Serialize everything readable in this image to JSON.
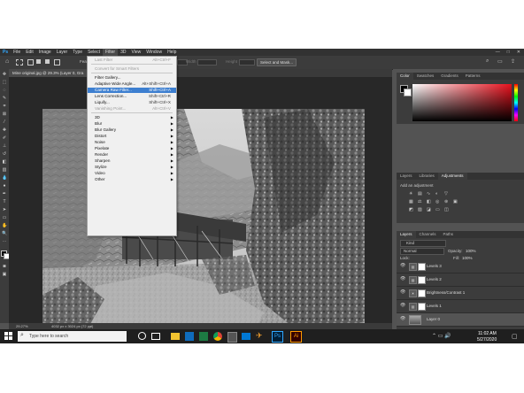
{
  "menubar": {
    "items": [
      "File",
      "Edit",
      "Image",
      "Layer",
      "Type",
      "Select",
      "Filter",
      "3D",
      "View",
      "Window",
      "Help"
    ],
    "active_index": 6,
    "window_controls": [
      "—",
      "□",
      "✕"
    ]
  },
  "options_bar": {
    "feather_label": "Feat",
    "width_label": "Width",
    "height_label": "Height",
    "select_mask_label": "Select and Mask..."
  },
  "document_tab": {
    "label": "Mine original.jpg @ 29.3% (Layer 0, Gra"
  },
  "status_bar": {
    "zoom": "29.27%",
    "doc_size": "4032 px x 3024 px (72 ppi)"
  },
  "filter_menu": {
    "items": [
      {
        "label": "Last Filter",
        "shortcut": "Alt+Ctrl+F",
        "disabled": true
      },
      {
        "separator": true
      },
      {
        "label": "Convert for Smart Filters",
        "shortcut": "",
        "disabled": true
      },
      {
        "separator": true
      },
      {
        "label": "Filter Gallery...",
        "shortcut": ""
      },
      {
        "label": "Adaptive Wide Angle...",
        "shortcut": "Alt+Shift+Ctrl+A"
      },
      {
        "label": "Camera Raw Filter...",
        "shortcut": "Shift+Ctrl+A",
        "highlighted": true
      },
      {
        "label": "Lens Correction...",
        "shortcut": "Shift+Ctrl+R"
      },
      {
        "label": "Liquify...",
        "shortcut": "Shift+Ctrl+X"
      },
      {
        "label": "Vanishing Point...",
        "shortcut": "Alt+Ctrl+V",
        "disabled": true
      },
      {
        "separator": true
      },
      {
        "label": "3D",
        "submenu": true
      },
      {
        "label": "Blur",
        "submenu": true
      },
      {
        "label": "Blur Gallery",
        "submenu": true
      },
      {
        "label": "Distort",
        "submenu": true
      },
      {
        "label": "Noise",
        "submenu": true
      },
      {
        "label": "Pixelate",
        "submenu": true
      },
      {
        "label": "Render",
        "submenu": true
      },
      {
        "label": "Sharpen",
        "submenu": true
      },
      {
        "label": "Stylize",
        "submenu": true
      },
      {
        "label": "Video",
        "submenu": true
      },
      {
        "label": "Other",
        "submenu": true
      }
    ]
  },
  "color_panel": {
    "tabs": [
      "Color",
      "Swatches",
      "Gradients",
      "Patterns"
    ],
    "active": 0
  },
  "adjust_panel": {
    "tabs": [
      "Layers",
      "Libraries",
      "Adjustments"
    ],
    "active": 2,
    "hint": "Add an adjustment"
  },
  "layers_panel": {
    "tabs": [
      "Layers",
      "Channels",
      "Paths"
    ],
    "kind_label": "Kind",
    "blend_mode": "Normal",
    "opacity_label": "Opacity:",
    "opacity": "100%",
    "lock_label": "Lock:",
    "fill_label": "Fill:",
    "fill": "100%",
    "layers": [
      {
        "name": "Levels 3",
        "icon": "levels-icon"
      },
      {
        "name": "Levels 2",
        "icon": "levels-icon"
      },
      {
        "name": "Brightness/Contrast 1",
        "icon": "brightness-icon"
      },
      {
        "name": "Levels 1",
        "icon": "levels-icon"
      },
      {
        "name": "Layer 0",
        "icon": "image-thumb",
        "selected": true
      }
    ]
  },
  "taskbar": {
    "search_placeholder": "Type here to search",
    "time": "11:02 AM",
    "date": "5/27/2020",
    "ps_label": "Ps",
    "ai_label": "Ai"
  },
  "colors": {
    "ps_bg": "#535353",
    "highlight": "#3d7fd0",
    "taskbar": "#1f1f1f"
  }
}
